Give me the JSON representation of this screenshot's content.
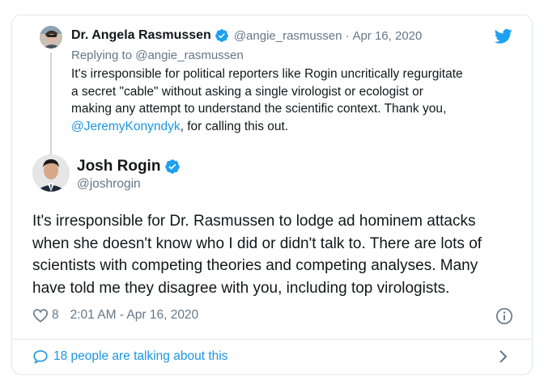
{
  "parent_tweet": {
    "author_name": "Dr. Angela Rasmussen",
    "handle": "@angie_rasmussen",
    "separator": "·",
    "date": "Apr 16, 2020",
    "replying_to": "Replying to @angie_rasmussen",
    "body_line1": "It's irresponsible for political reporters like Rogin uncritically regurgitate",
    "body_line2": "a secret \"cable\" without asking a single virologist or ecologist or",
    "body_line3": "making any attempt to understand the scientific context. Thank you,",
    "mention": "@JeremyKonyndyk",
    "body_tail": ", for calling this out."
  },
  "main_tweet": {
    "author_name": "Josh Rogin",
    "handle": "@joshrogin",
    "body_line1": "It's irresponsible for Dr. Rasmussen to lodge ad hominem attacks",
    "body_line2": "when she doesn't know who I did or didn't talk to. There are lots of",
    "body_line3": "scientists with competing theories and competing analyses. Many",
    "body_line4": "have told me they disagree with you, including top virologists.",
    "likes": "8",
    "timestamp": "2:01 AM - Apr 16, 2020"
  },
  "footer": {
    "talking_text": "18 people are talking about this"
  },
  "icons": {
    "verified": "verified-badge-icon",
    "bird": "twitter-bird-icon",
    "heart": "heart-icon",
    "info": "info-icon",
    "bubble": "speech-bubble-icon",
    "chevron": "chevron-right-icon"
  },
  "colors": {
    "twitter_blue": "#1da1f2",
    "link_blue": "#1b95e0",
    "secondary_text": "#657786",
    "border": "#e1e8ed"
  }
}
